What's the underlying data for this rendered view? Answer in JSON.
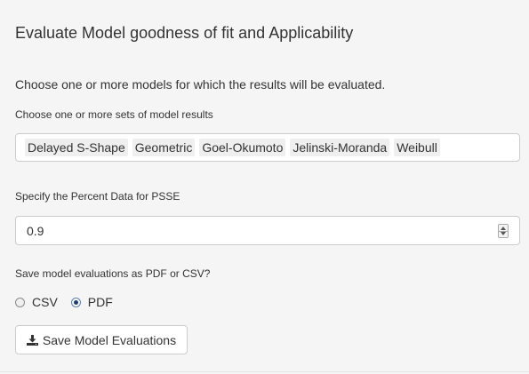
{
  "panel": {
    "title": "Evaluate Model goodness of fit and Applicability",
    "intro": "Choose one or more models for which the results will be evaluated."
  },
  "models_select": {
    "label": "Choose one or more sets of model results",
    "selected": [
      "Delayed S-Shape",
      "Geometric",
      "Goel-Okumoto",
      "Jelinski-Moranda",
      "Weibull"
    ]
  },
  "psse": {
    "label": "Specify the Percent Data for PSSE",
    "value": "0.9"
  },
  "format": {
    "label": "Save model evaluations as PDF or CSV?",
    "options": [
      {
        "label": "CSV",
        "checked": false
      },
      {
        "label": "PDF",
        "checked": true
      }
    ]
  },
  "save_button": {
    "label": "Save Model Evaluations",
    "icon": "download-icon"
  }
}
